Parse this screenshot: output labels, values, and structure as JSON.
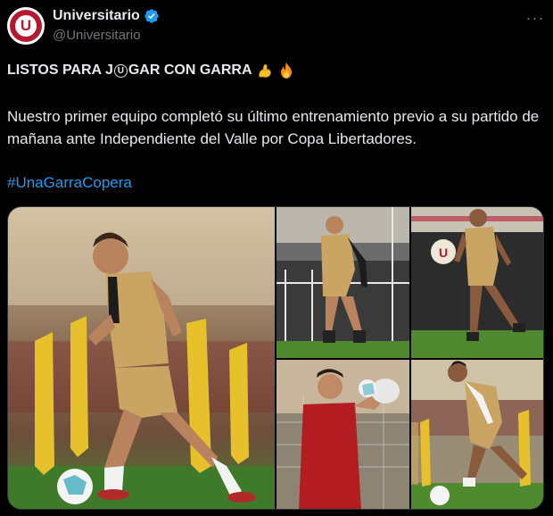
{
  "account": {
    "display_name": "Universitario",
    "handle": "@Universitario",
    "avatar_letter": "U",
    "brand_color": "#b5192f",
    "verified_color": "#1d9bf0"
  },
  "post": {
    "headline_part1": "LISTOS PARA J",
    "headline_glyph": "U",
    "headline_part2": "GAR CON GARRA",
    "headline_emojis": [
      "flexed-biceps-emoji",
      "fire-emoji"
    ],
    "body": "Nuestro primer equipo completó su último entrenamiento previo a su partido de mañana ante Independiente del Valle por Copa Libertadores.",
    "hashtag": "#UnaGarraCopera",
    "hashtag_color": "#1d9bf0"
  },
  "media": {
    "photos": [
      {
        "name": "player-with-ball-photo"
      },
      {
        "name": "player-running-photo"
      },
      {
        "name": "player-jogging-photo"
      },
      {
        "name": "goalkeeper-catching-photo"
      },
      {
        "name": "player-dribbling-photo"
      }
    ]
  },
  "icons": {
    "more": "more-options-icon",
    "verified": "verified-badge-icon"
  }
}
